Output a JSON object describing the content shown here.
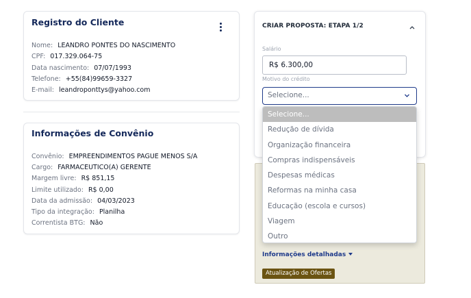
{
  "client": {
    "title": "Registro do Cliente",
    "fields": [
      {
        "label": "Nome:",
        "value": "LEANDRO PONTES DO NASCIMENTO"
      },
      {
        "label": "CPF:",
        "value": "017.329.064-75"
      },
      {
        "label": "Data nascimento:",
        "value": "07/07/1993"
      },
      {
        "label": "Telefone:",
        "value": "+55(84)99659-3327"
      },
      {
        "label": "E-mail:",
        "value": "leandroponttys@yahoo.com"
      }
    ]
  },
  "agreement": {
    "title": "Informações de Convênio",
    "fields": [
      {
        "label": "Convênio:",
        "value": "EMPREENDIMENTOS PAGUE MENOS S/A"
      },
      {
        "label": "Cargo:",
        "value": "FARMACEUTICO(A) GERENTE"
      },
      {
        "label": "Margem livre:",
        "value": "R$ 851,15"
      },
      {
        "label": "Limite utilizado:",
        "value": "R$ 0,00"
      },
      {
        "label": "Data da admissão:",
        "value": "04/03/2023"
      },
      {
        "label": "Tipo da integração:",
        "value": "Planilha"
      },
      {
        "label": "Correntista BTG:",
        "value": "Não"
      }
    ]
  },
  "proposal": {
    "title": "CRIAR PROPOSTA: ETAPA 1/2",
    "salary_label": "Salário",
    "salary_value": "R$ 6.300,00",
    "purpose_label": "Motivo do crédito",
    "purpose_selected": "Selecione...",
    "options": [
      "Selecione...",
      "Redução de dívida",
      "Organização financeira",
      "Compras indispensáveis",
      "Despesas médicas",
      "Reformas na minha casa",
      "Educação (escola e cursos)",
      "Viagem",
      "Outro"
    ],
    "highlighted_option": 0
  },
  "offers": {
    "details_link": "Informações detalhadas",
    "update_badge": "Atualização de Ofertas"
  },
  "icons": {
    "menu": "kebab-menu-icon",
    "collapse": "chevron-up-icon",
    "select_arrow": "chevron-down-icon",
    "details_arrow": "caret-down-icon"
  },
  "colors": {
    "title_navy": "#14285a",
    "select_border": "#1e3a8a",
    "offers_bg": "#eceadd",
    "badge_bg": "#6b5412",
    "selected_option_bg": "#bdbdbd"
  }
}
